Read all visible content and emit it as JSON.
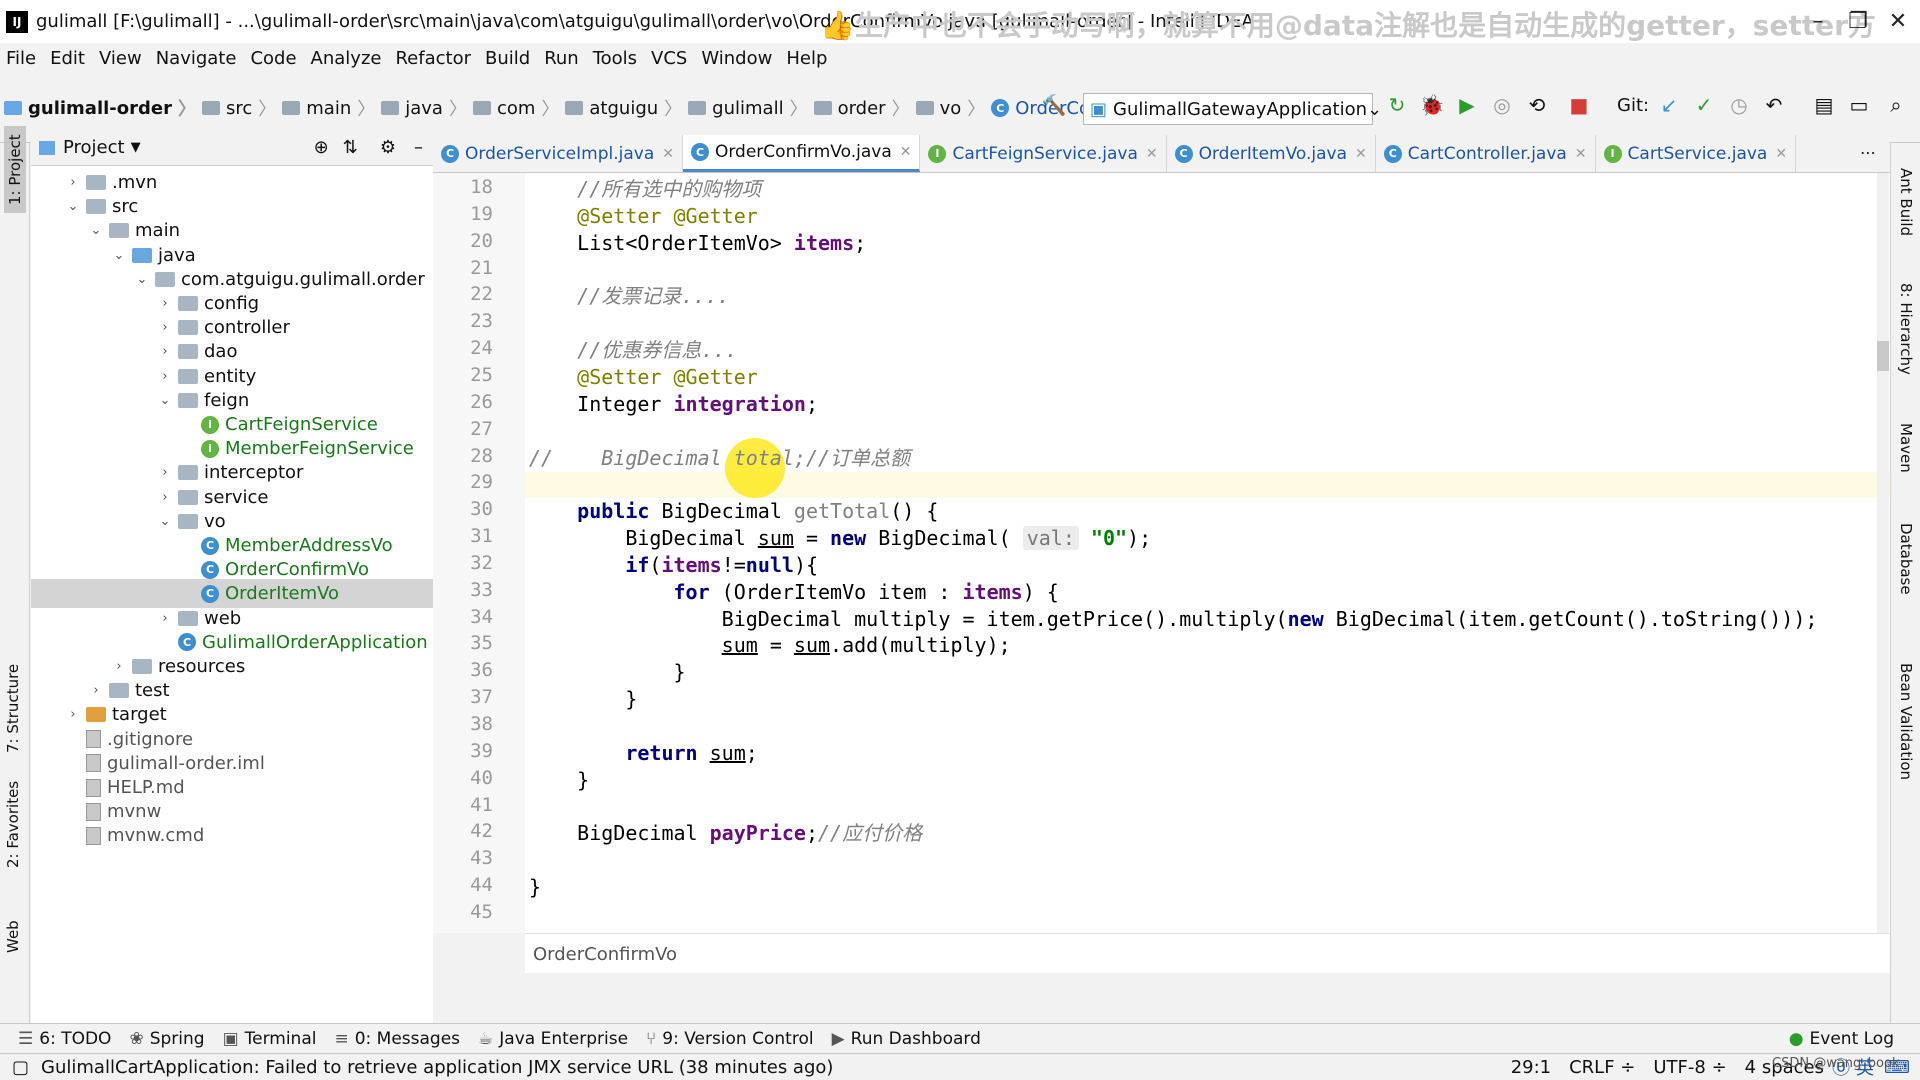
{
  "window": {
    "title": "gulimall [F:\\gulimall] - ...\\gulimall-order\\src\\main\\java\\com\\atguigu\\gulimall\\order\\vo\\OrderConfirmVo.java [gulimall-order] - IntelliJ IDEA",
    "overlay": "👍生产中也不会手动写啊，就算不用@data注解也是自动生成的getter，setter方"
  },
  "menu": [
    "File",
    "Edit",
    "View",
    "Navigate",
    "Code",
    "Analyze",
    "Refactor",
    "Build",
    "Run",
    "Tools",
    "VCS",
    "Window",
    "Help"
  ],
  "breadcrumbs": [
    "gulimall-order",
    "src",
    "main",
    "java",
    "com",
    "atguigu",
    "gulimall",
    "order",
    "vo",
    "OrderConfirmVo"
  ],
  "toolbar": {
    "run_config": "GulimallGatewayApplication",
    "git_label": "Git:"
  },
  "project_panel": {
    "title": "Project"
  },
  "tree": [
    {
      "label": ".mvn",
      "depth": 1,
      "arrow": "›",
      "type": "folder"
    },
    {
      "label": "src",
      "depth": 1,
      "arrow": "⌄",
      "type": "folder"
    },
    {
      "label": "main",
      "depth": 2,
      "arrow": "⌄",
      "type": "folder"
    },
    {
      "label": "java",
      "depth": 3,
      "arrow": "⌄",
      "type": "folder-blue"
    },
    {
      "label": "com.atguigu.gulimall.order",
      "depth": 4,
      "arrow": "⌄",
      "type": "folder"
    },
    {
      "label": "config",
      "depth": 5,
      "arrow": "›",
      "type": "folder"
    },
    {
      "label": "controller",
      "depth": 5,
      "arrow": "›",
      "type": "folder"
    },
    {
      "label": "dao",
      "depth": 5,
      "arrow": "›",
      "type": "folder"
    },
    {
      "label": "entity",
      "depth": 5,
      "arrow": "›",
      "type": "folder"
    },
    {
      "label": "feign",
      "depth": 5,
      "arrow": "⌄",
      "type": "folder"
    },
    {
      "label": "CartFeignService",
      "depth": 6,
      "arrow": "",
      "type": "interface"
    },
    {
      "label": "MemberFeignService",
      "depth": 6,
      "arrow": "",
      "type": "interface"
    },
    {
      "label": "interceptor",
      "depth": 5,
      "arrow": "›",
      "type": "folder"
    },
    {
      "label": "service",
      "depth": 5,
      "arrow": "›",
      "type": "folder"
    },
    {
      "label": "vo",
      "depth": 5,
      "arrow": "⌄",
      "type": "folder"
    },
    {
      "label": "MemberAddressVo",
      "depth": 6,
      "arrow": "",
      "type": "class"
    },
    {
      "label": "OrderConfirmVo",
      "depth": 6,
      "arrow": "",
      "type": "class"
    },
    {
      "label": "OrderItemVo",
      "depth": 6,
      "arrow": "",
      "type": "class",
      "selected": true
    },
    {
      "label": "web",
      "depth": 5,
      "arrow": "›",
      "type": "folder"
    },
    {
      "label": "GulimallOrderApplication",
      "depth": 5,
      "arrow": "",
      "type": "class"
    },
    {
      "label": "resources",
      "depth": 3,
      "arrow": "›",
      "type": "folder"
    },
    {
      "label": "test",
      "depth": 2,
      "arrow": "›",
      "type": "folder"
    },
    {
      "label": "target",
      "depth": 1,
      "arrow": "›",
      "type": "folder-orange"
    },
    {
      "label": ".gitignore",
      "depth": 1,
      "arrow": "",
      "type": "file"
    },
    {
      "label": "gulimall-order.iml",
      "depth": 1,
      "arrow": "",
      "type": "file"
    },
    {
      "label": "HELP.md",
      "depth": 1,
      "arrow": "",
      "type": "file"
    },
    {
      "label": "mvnw",
      "depth": 1,
      "arrow": "",
      "type": "file"
    },
    {
      "label": "mvnw.cmd",
      "depth": 1,
      "arrow": "",
      "type": "file"
    }
  ],
  "tabs": [
    {
      "label": "OrderServiceImpl.java",
      "icon": "C"
    },
    {
      "label": "OrderConfirmVo.java",
      "icon": "C",
      "active": true
    },
    {
      "label": "CartFeignService.java",
      "icon": "I"
    },
    {
      "label": "OrderItemVo.java",
      "icon": "C"
    },
    {
      "label": "CartController.java",
      "icon": "C"
    },
    {
      "label": "CartService.java",
      "icon": "I"
    }
  ],
  "code": [
    {
      "n": "18",
      "html": "    <span class='cm'>//所有选中的购物项</span>"
    },
    {
      "n": "19",
      "html": "    <span class='an'>@Setter @Getter</span>"
    },
    {
      "n": "20",
      "html": "    List&lt;OrderItemVo&gt; <span class='fd'>items</span>;"
    },
    {
      "n": "21",
      "html": ""
    },
    {
      "n": "22",
      "html": "    <span class='cm'>//发票记录....</span>"
    },
    {
      "n": "23",
      "html": ""
    },
    {
      "n": "24",
      "html": "    <span class='cm'>//优惠券信息...</span>"
    },
    {
      "n": "25",
      "html": "    <span class='an'>@Setter @Getter</span>"
    },
    {
      "n": "26",
      "html": "    Integer <span class='fd'>integration</span>;"
    },
    {
      "n": "27",
      "html": ""
    },
    {
      "n": "28",
      "html": "<span class='cm'>//    BigDecimal total;//订单总额</span>"
    },
    {
      "n": "29",
      "html": ""
    },
    {
      "n": "30",
      "html": "    <span class='kw'>public</span> BigDecimal <span class='mt'>getTotal</span>() {"
    },
    {
      "n": "31",
      "html": "        BigDecimal <u>sum</u> = <span class='kw'>new</span> BigDecimal( <span class='hint'>val:</span> <span class='st'>\"0\"</span>);"
    },
    {
      "n": "32",
      "html": "        <span class='kw'>if</span>(<span class='fd'>items</span>!=<span class='kw'>null</span>){"
    },
    {
      "n": "33",
      "html": "            <span class='kw'>for</span> (OrderItemVo item : <span class='fd'>items</span>) {"
    },
    {
      "n": "34",
      "html": "                BigDecimal multiply = item.getPrice().multiply(<span class='kw'>new</span> BigDecimal(item.getCount().toString()));"
    },
    {
      "n": "35",
      "html": "                <u>sum</u> = <u>sum</u>.add(multiply);"
    },
    {
      "n": "36",
      "html": "            }"
    },
    {
      "n": "37",
      "html": "        }"
    },
    {
      "n": "38",
      "html": ""
    },
    {
      "n": "39",
      "html": "        <span class='kw'>return</span> <u>sum</u>;"
    },
    {
      "n": "40",
      "html": "    }"
    },
    {
      "n": "41",
      "html": ""
    },
    {
      "n": "42",
      "html": "    BigDecimal <span class='fd'>payPrice</span>;<span class='cm'>//应付价格</span>"
    },
    {
      "n": "43",
      "html": ""
    },
    {
      "n": "44",
      "html": "}"
    },
    {
      "n": "45",
      "html": ""
    }
  ],
  "editor_footer": "OrderConfirmVo",
  "left_tools": [
    "1: Project",
    "7: Structure",
    "2: Favorites",
    "Web"
  ],
  "right_tools": [
    "Ant Build",
    "8: Hierarchy",
    "Maven",
    "Database",
    "Bean Validation"
  ],
  "bottom_tools": [
    "6: TODO",
    "Spring",
    "Terminal",
    "0: Messages",
    "Java Enterprise",
    "9: Version Control",
    "Run Dashboard"
  ],
  "event_log": "Event Log",
  "status": {
    "message": "GulimallCartApplication: Failed to retrieve application JMX service URL (38 minutes ago)",
    "position": "29:1",
    "line_sep": "CRLF ÷",
    "encoding": "UTF-8 ÷",
    "indent": "4 spaces",
    "ime": "英",
    "watermark": "CSDN @wang_book"
  }
}
